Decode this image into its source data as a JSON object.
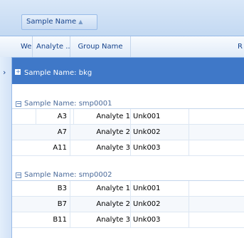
{
  "group_panel": {
    "chip_label": "Sample Name",
    "sort_glyph": "▲"
  },
  "columns": [
    {
      "label": "Well"
    },
    {
      "label": "Analyte ..."
    },
    {
      "label": "Group Name"
    },
    {
      "label": "R"
    }
  ],
  "groups": [
    {
      "label": "Sample Name: bkg",
      "expand_glyph": "+",
      "selected": true,
      "rows": []
    },
    {
      "label": "Sample Name: smp0001",
      "expand_glyph": "−",
      "selected": false,
      "rows": [
        {
          "well": "A3",
          "analyte": "Analyte 1",
          "group": "Unk001"
        },
        {
          "well": "A7",
          "analyte": "Analyte 2",
          "group": "Unk002"
        },
        {
          "well": "A11",
          "analyte": "Analyte 3",
          "group": "Unk003"
        }
      ]
    },
    {
      "label": "Sample Name: smp0002",
      "expand_glyph": "−",
      "selected": false,
      "rows": [
        {
          "well": "B3",
          "analyte": "Analyte 1",
          "group": "Unk001"
        },
        {
          "well": "B7",
          "analyte": "Analyte 2",
          "group": "Unk002"
        },
        {
          "well": "B11",
          "analyte": "Analyte 3",
          "group": "Unk003"
        }
      ]
    }
  ],
  "row_indicator_glyph": "›",
  "colors": {
    "selected_group": "#3f78c8",
    "header_text": "#15428b",
    "border": "#99bbe8"
  }
}
